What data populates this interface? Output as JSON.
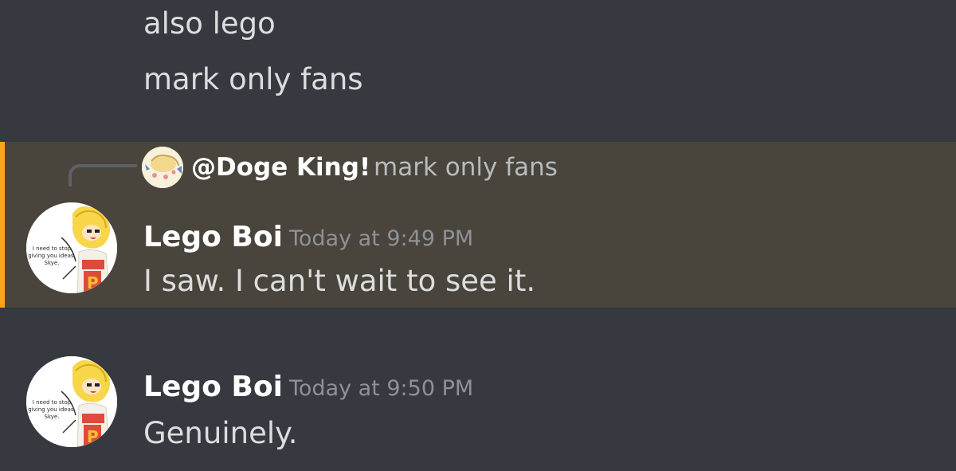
{
  "continuation_messages": [
    {
      "text": "also lego"
    },
    {
      "text": "mark only fans"
    }
  ],
  "mention_message": {
    "reply": {
      "author": "@Doge King!",
      "content": "mark only fans"
    },
    "author": "Lego Boi",
    "timestamp": "Today at 9:49 PM",
    "text": "I saw. I can't wait to see it.",
    "avatar_caption": "I need to stop giving you ideas, Skye."
  },
  "second_message": {
    "author": "Lego Boi",
    "timestamp": "Today at 9:50 PM",
    "text": "Genuinely.",
    "avatar_caption": "I need to stop giving you ideas, Skye."
  },
  "colors": {
    "background": "#36393f",
    "mention_highlight": "#49443c",
    "mention_bar": "#faa61a",
    "username": "#ffffff",
    "timestamp": "#8e9297",
    "message_text": "#dcddde"
  }
}
